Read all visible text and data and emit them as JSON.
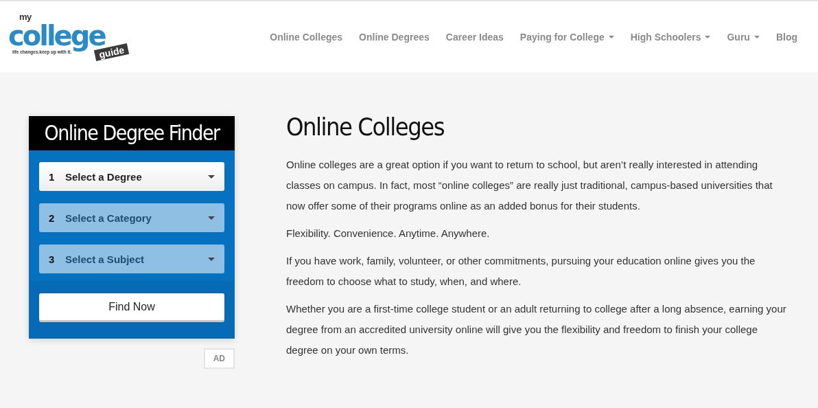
{
  "logo": {
    "top": "my",
    "main": "college",
    "badge": "guide",
    "tagline": "life changes.keep up with it."
  },
  "nav": [
    {
      "label": "Online Colleges",
      "has_menu": false
    },
    {
      "label": "Online Degrees",
      "has_menu": false
    },
    {
      "label": "Career Ideas",
      "has_menu": false
    },
    {
      "label": "Paying for College",
      "has_menu": true
    },
    {
      "label": "High Schoolers",
      "has_menu": true
    },
    {
      "label": "Guru",
      "has_menu": true
    },
    {
      "label": "Blog",
      "has_menu": false
    }
  ],
  "finder": {
    "title": "Online Degree Finder",
    "selects": [
      {
        "number": "1",
        "label": "Select a Degree",
        "disabled": false
      },
      {
        "number": "2",
        "label": "Select a Category",
        "disabled": true
      },
      {
        "number": "3",
        "label": "Select a Subject",
        "disabled": true
      }
    ],
    "button": "Find Now",
    "ad_label": "AD"
  },
  "article": {
    "title": "Online Colleges",
    "paragraphs": [
      "Online colleges are a great option if you want to return to school, but aren’t really interested in attending classes on campus. In fact, most “online colleges” are really just traditional, campus-based universities that now offer some of their programs online as an added bonus for their students.",
      "Flexibility. Convenience. Anytime. Anywhere.",
      "If you have work, family, volunteer, or other commitments, pursuing your education online gives you the freedom to choose what to study, when, and where.",
      "Whether you are a first-time college student or an adult returning to college after a long absence, earning your degree from an accredited university online will give you the flexibility and freedom to finish your college degree on your own terms."
    ]
  }
}
